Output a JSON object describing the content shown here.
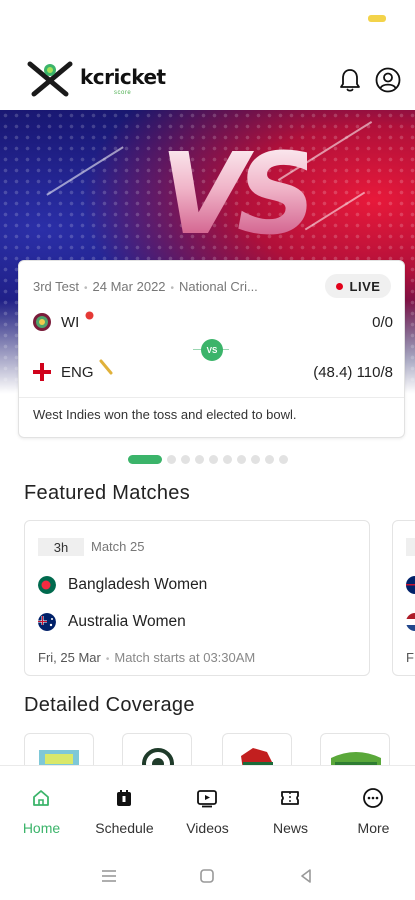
{
  "app": {
    "logo_text": "kcricket",
    "logo_sub": "score"
  },
  "header": {
    "icons": [
      "bell-icon",
      "user-icon"
    ]
  },
  "hero": {
    "vs_text": "VS"
  },
  "live_match": {
    "match_no": "3rd Test",
    "date": "24 Mar 2022",
    "venue": "National Cri...",
    "status": "LIVE",
    "vs_badge": "VS",
    "team1": {
      "name": "WI",
      "score": "0/0"
    },
    "team2": {
      "name": "ENG",
      "score": "(48.4) 110/8"
    },
    "toss": "West Indies won the toss and elected to bowl."
  },
  "carousel": {
    "count": 10,
    "active": 0
  },
  "featured": {
    "title": "Featured Matches",
    "card": {
      "time_left": "3h",
      "match_no": "Match 25",
      "team1": "Bangladesh Women",
      "team2": "Australia Women",
      "date": "Fri, 25 Mar",
      "start_text": "Match starts at 03:30AM"
    },
    "peek_date_fragment": "F"
  },
  "coverage": {
    "title": "Detailed Coverage"
  },
  "bottom_nav": {
    "items": [
      {
        "label": "Home",
        "icon": "home-icon",
        "active": true
      },
      {
        "label": "Schedule",
        "icon": "calendar-icon",
        "active": false
      },
      {
        "label": "Videos",
        "icon": "video-icon",
        "active": false
      },
      {
        "label": "News",
        "icon": "news-icon",
        "active": false
      },
      {
        "label": "More",
        "icon": "more-icon",
        "active": false
      }
    ]
  },
  "colors": {
    "accent": "#3bb46a",
    "live": "#e2001a"
  }
}
